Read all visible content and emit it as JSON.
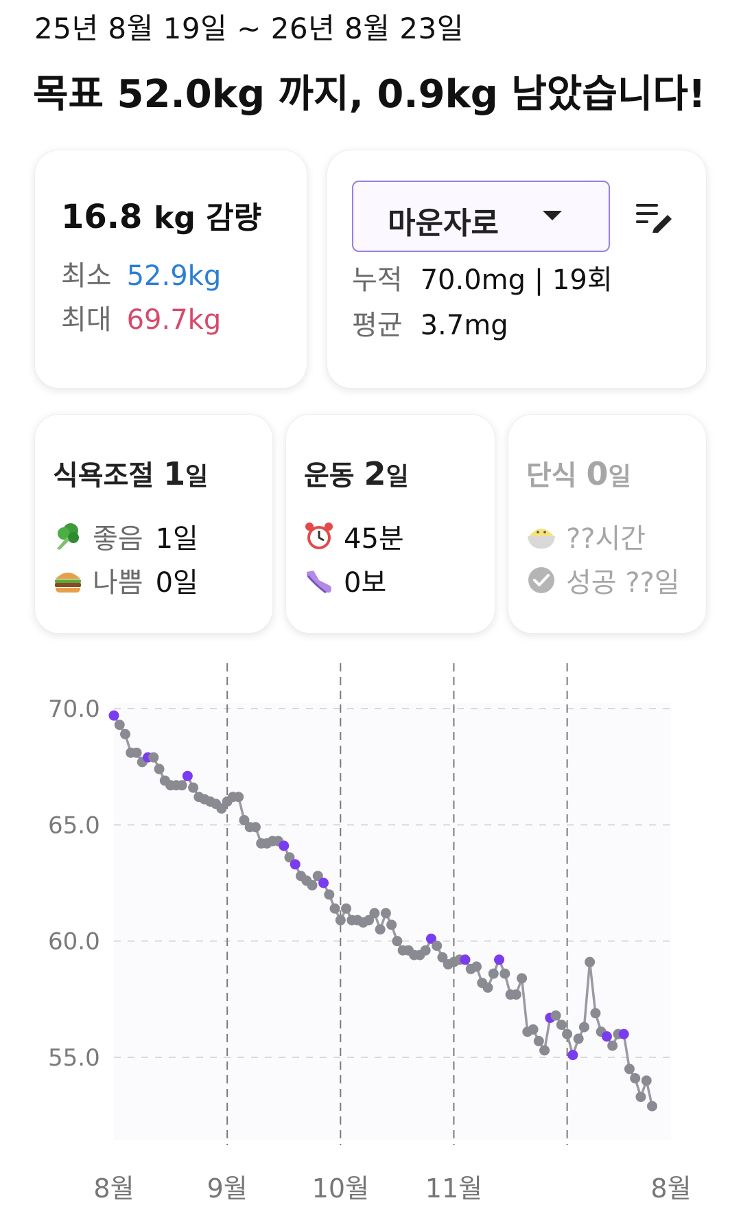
{
  "header": {
    "date_range": "25년 8월 19일 ~ 26년 8월 23일",
    "goal_text": "목표 52.0kg 까지, 0.9kg 남았습니다!"
  },
  "loss_card": {
    "amount": "16.8",
    "unit": "kg 감량",
    "min_label": "최소",
    "min_value": "52.9kg",
    "max_label": "최대",
    "max_value": "69.7kg"
  },
  "medication_card": {
    "selected": "마운자로",
    "total_label": "누적",
    "total_value": "70.0mg | 19회",
    "avg_label": "평균",
    "avg_value": "3.7mg",
    "edit_icon": "edit-list-icon"
  },
  "diet_card": {
    "title": "식욕조절",
    "count": "1",
    "day_unit": "일",
    "good_label": "좋음",
    "good_value": "1일",
    "bad_label": "나쁨",
    "bad_value": "0일",
    "good_icon": "broccoli-icon",
    "bad_icon": "burger-icon"
  },
  "exercise_card": {
    "title": "운동",
    "count": "2",
    "day_unit": "일",
    "time_value": "45분",
    "steps_value": "0보",
    "time_icon": "alarm-clock-icon",
    "steps_icon": "sneaker-icon"
  },
  "fasting_card": {
    "title": "단식",
    "count": "0",
    "day_unit": "일",
    "hours_value": "??시간",
    "success_value": "성공 ??일",
    "hours_icon": "rice-bowl-icon",
    "success_icon": "check-circle-icon"
  },
  "colors": {
    "line": "#9a9aa2",
    "point": "#8a8a93",
    "highlight_point": "#7b3cf0",
    "grid": "#d9d9d9",
    "min_value": "#2a7fd4",
    "max_value": "#d64a6b",
    "dropdown_border": "#9b7fe0"
  },
  "chart_data": {
    "type": "line",
    "title": "",
    "ylim": [
      51.5,
      72
    ],
    "y_ticks": [
      "70.0",
      "65.0",
      "60.0",
      "55.0"
    ],
    "y_tick_values": [
      70,
      65,
      60,
      55
    ],
    "x_tick_labels": [
      "8월",
      "9월",
      "10월",
      "11월",
      "8월"
    ],
    "x_tick_days": [
      0,
      12,
      24,
      36,
      59
    ],
    "vlines_days": [
      12,
      24,
      36,
      48
    ],
    "grid": true,
    "series": [
      {
        "points": [
          [
            0,
            69.7,
            1
          ],
          [
            0.6,
            69.3,
            0
          ],
          [
            1.2,
            68.9,
            0
          ],
          [
            1.8,
            68.1,
            0
          ],
          [
            2.4,
            68.1,
            0
          ],
          [
            3.0,
            67.7,
            0
          ],
          [
            3.6,
            67.9,
            1
          ],
          [
            4.2,
            67.9,
            0
          ],
          [
            4.8,
            67.4,
            0
          ],
          [
            5.4,
            66.9,
            0
          ],
          [
            6.0,
            66.7,
            0
          ],
          [
            6.6,
            66.7,
            0
          ],
          [
            7.2,
            66.7,
            0
          ],
          [
            7.8,
            67.1,
            1
          ],
          [
            8.4,
            66.6,
            0
          ],
          [
            9.0,
            66.2,
            0
          ],
          [
            9.6,
            66.1,
            0
          ],
          [
            10.2,
            66.0,
            0
          ],
          [
            10.8,
            65.9,
            0
          ],
          [
            11.4,
            65.7,
            0
          ],
          [
            12.0,
            66.0,
            0
          ],
          [
            12.6,
            66.2,
            0
          ],
          [
            13.2,
            66.2,
            0
          ],
          [
            13.8,
            65.2,
            0
          ],
          [
            14.4,
            64.9,
            0
          ],
          [
            15.0,
            64.9,
            0
          ],
          [
            15.6,
            64.2,
            0
          ],
          [
            16.2,
            64.2,
            0
          ],
          [
            16.8,
            64.3,
            0
          ],
          [
            17.4,
            64.3,
            0
          ],
          [
            18.0,
            64.1,
            1
          ],
          [
            18.6,
            63.6,
            0
          ],
          [
            19.2,
            63.3,
            1
          ],
          [
            19.8,
            62.8,
            0
          ],
          [
            20.4,
            62.6,
            0
          ],
          [
            21.0,
            62.4,
            0
          ],
          [
            21.6,
            62.8,
            0
          ],
          [
            22.2,
            62.5,
            1
          ],
          [
            22.8,
            62.0,
            0
          ],
          [
            23.4,
            61.4,
            0
          ],
          [
            24.0,
            60.9,
            0
          ],
          [
            24.6,
            61.4,
            0
          ],
          [
            25.2,
            60.9,
            0
          ],
          [
            25.8,
            60.9,
            0
          ],
          [
            26.4,
            60.8,
            0
          ],
          [
            27.0,
            60.9,
            0
          ],
          [
            27.6,
            61.2,
            0
          ],
          [
            28.2,
            60.5,
            0
          ],
          [
            28.8,
            61.2,
            0
          ],
          [
            29.4,
            60.7,
            0
          ],
          [
            30.0,
            60.0,
            0
          ],
          [
            30.6,
            59.6,
            0
          ],
          [
            31.2,
            59.6,
            0
          ],
          [
            31.8,
            59.4,
            0
          ],
          [
            32.4,
            59.4,
            0
          ],
          [
            33.0,
            59.6,
            0
          ],
          [
            33.6,
            60.1,
            1
          ],
          [
            34.2,
            59.8,
            0
          ],
          [
            34.8,
            59.3,
            0
          ],
          [
            35.4,
            59.0,
            0
          ],
          [
            36.0,
            59.1,
            0
          ],
          [
            36.6,
            59.2,
            0
          ],
          [
            37.2,
            59.2,
            1
          ],
          [
            37.8,
            58.8,
            0
          ],
          [
            38.4,
            58.9,
            0
          ],
          [
            39.0,
            58.2,
            0
          ],
          [
            39.6,
            58.0,
            0
          ],
          [
            40.2,
            58.6,
            0
          ],
          [
            40.8,
            59.2,
            1
          ],
          [
            41.4,
            58.6,
            0
          ],
          [
            42.0,
            57.7,
            0
          ],
          [
            42.6,
            57.7,
            0
          ],
          [
            43.2,
            58.4,
            0
          ],
          [
            43.8,
            56.1,
            0
          ],
          [
            44.4,
            56.2,
            0
          ],
          [
            45.0,
            55.7,
            0
          ],
          [
            45.6,
            55.3,
            0
          ],
          [
            46.2,
            56.7,
            1
          ],
          [
            46.8,
            56.8,
            0
          ],
          [
            47.4,
            56.4,
            0
          ],
          [
            48.0,
            56.0,
            0
          ],
          [
            48.6,
            55.1,
            1
          ],
          [
            49.2,
            55.8,
            0
          ],
          [
            49.8,
            56.3,
            0
          ],
          [
            50.4,
            59.1,
            0
          ],
          [
            51.0,
            56.9,
            0
          ],
          [
            51.6,
            56.1,
            0
          ],
          [
            52.2,
            55.9,
            1
          ],
          [
            52.8,
            55.5,
            0
          ],
          [
            53.4,
            56.0,
            0
          ],
          [
            54.0,
            56.0,
            1
          ],
          [
            54.6,
            54.5,
            0
          ],
          [
            55.2,
            54.1,
            0
          ],
          [
            55.8,
            53.3,
            0
          ],
          [
            56.4,
            54.0,
            0
          ],
          [
            57.0,
            52.9,
            0
          ]
        ]
      }
    ]
  }
}
